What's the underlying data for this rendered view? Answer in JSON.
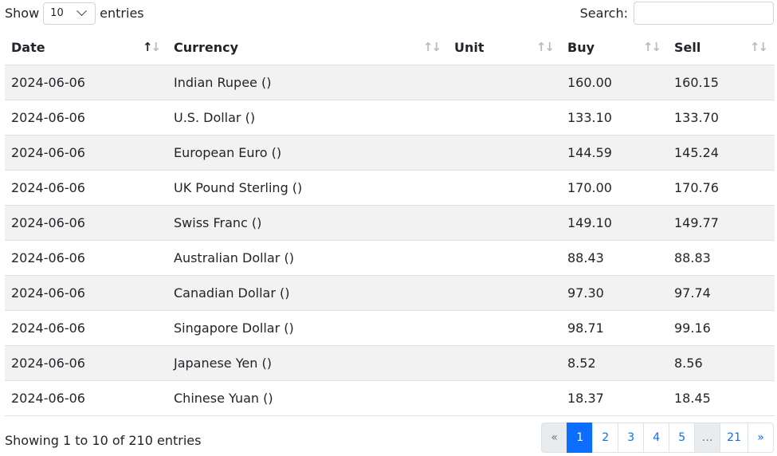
{
  "length": {
    "prefix": "Show",
    "value": "10",
    "suffix": "entries"
  },
  "search": {
    "label": "Search:",
    "value": "",
    "placeholder": ""
  },
  "table": {
    "columns": [
      "Date",
      "Currency",
      "Unit",
      "Buy",
      "Sell"
    ],
    "rows": [
      [
        "2024-06-06",
        "Indian Rupee ()",
        "",
        "160.00",
        "160.15"
      ],
      [
        "2024-06-06",
        "U.S. Dollar ()",
        "",
        "133.10",
        "133.70"
      ],
      [
        "2024-06-06",
        "European Euro ()",
        "",
        "144.59",
        "145.24"
      ],
      [
        "2024-06-06",
        "UK Pound Sterling ()",
        "",
        "170.00",
        "170.76"
      ],
      [
        "2024-06-06",
        "Swiss Franc ()",
        "",
        "149.10",
        "149.77"
      ],
      [
        "2024-06-06",
        "Australian Dollar ()",
        "",
        "88.43",
        "88.83"
      ],
      [
        "2024-06-06",
        "Canadian Dollar ()",
        "",
        "97.30",
        "97.74"
      ],
      [
        "2024-06-06",
        "Singapore Dollar ()",
        "",
        "98.71",
        "99.16"
      ],
      [
        "2024-06-06",
        "Japanese Yen ()",
        "",
        "8.52",
        "8.56"
      ],
      [
        "2024-06-06",
        "Chinese Yuan ()",
        "",
        "18.37",
        "18.45"
      ]
    ]
  },
  "info": "Showing 1 to 10 of 210 entries",
  "pagination": {
    "prev": "«",
    "pages": [
      "1",
      "2",
      "3",
      "4",
      "5",
      "…",
      "21"
    ],
    "next": "»",
    "active": "1"
  },
  "colors": {
    "accent": "#0d6efd",
    "stripe": "#f2f2f2",
    "border": "#dee2e6"
  }
}
